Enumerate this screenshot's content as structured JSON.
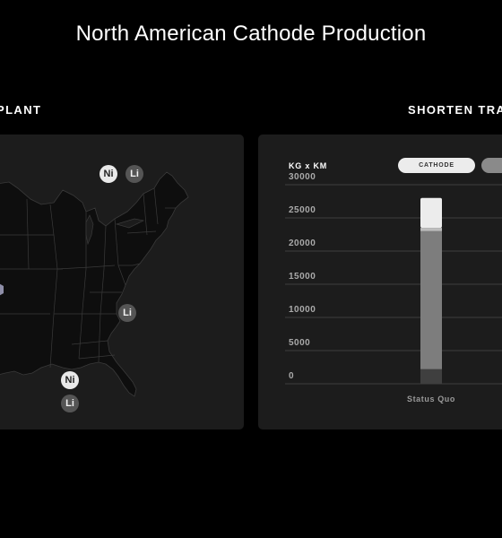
{
  "page": {
    "title": "North American Cathode Production"
  },
  "sections": {
    "left_label": "PLANT",
    "right_label": "SHORTEN TRA"
  },
  "map": {
    "markers": [
      {
        "symbol": "Ni",
        "type": "ni"
      },
      {
        "symbol": "Li",
        "type": "li"
      },
      {
        "symbol": "Li",
        "type": "li"
      },
      {
        "symbol": "Ni",
        "type": "ni"
      },
      {
        "symbol": "Li",
        "type": "li"
      }
    ],
    "colors": {
      "land": "#0e0e0e",
      "border": "#3a3a3a",
      "plant": "#8e8ea8"
    }
  },
  "chart_panel": {
    "unit_label": "KG x KM",
    "toggles": [
      {
        "label": "CATHODE",
        "active": true
      },
      {
        "label": "",
        "active": false
      }
    ]
  },
  "chart_data": {
    "type": "bar",
    "stacked": true,
    "categories": [
      "Status Quo"
    ],
    "series": [
      {
        "values": [
          2200
        ],
        "color": "#3f3f3f"
      },
      {
        "values": [
          20800
        ],
        "color": "#7d7d7d"
      },
      {
        "values": [
          500
        ],
        "color": "#bdbdbd"
      },
      {
        "values": [
          4500
        ],
        "color": "#ececec"
      }
    ],
    "ylim": [
      0,
      30000
    ],
    "yticks": [
      "0",
      "5000",
      "10000",
      "15000",
      "20000",
      "25000",
      "30000"
    ],
    "grid": true,
    "ylabel": "KG x KM"
  }
}
